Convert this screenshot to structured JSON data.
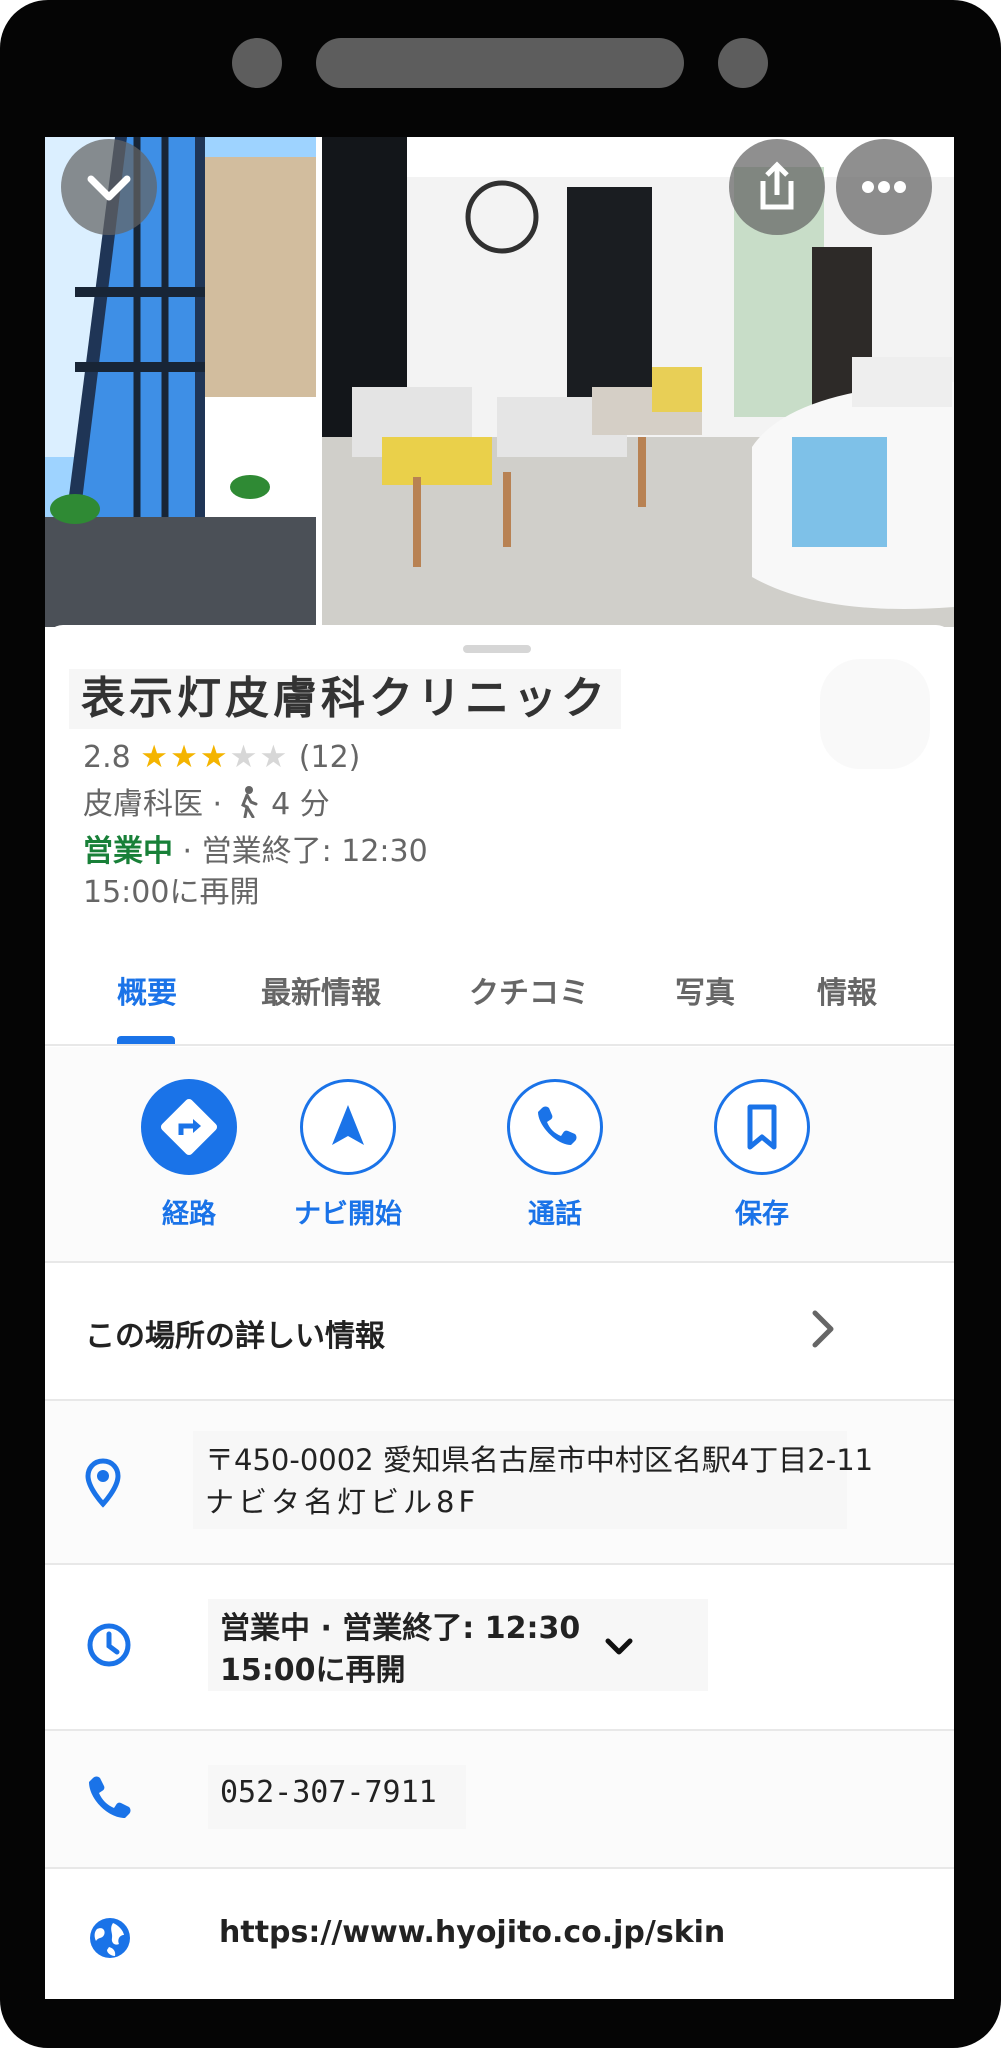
{
  "place": {
    "name": "表示灯皮膚科クリニック",
    "rating": "2.8",
    "stars_filled": 3,
    "stars_total": 5,
    "review_count": "(12)",
    "category": "皮膚科医",
    "separator": " · ",
    "walk_time": "4 分",
    "status_open": "営業中",
    "status_close": " · 営業終了: 12:30",
    "reopen": "15:00に再開"
  },
  "tabs": [
    "概要",
    "最新情報",
    "クチコミ",
    "写真",
    "情報"
  ],
  "actions": [
    {
      "label": "経路",
      "icon": "directions-icon"
    },
    {
      "label": "ナビ開始",
      "icon": "navigation-icon"
    },
    {
      "label": "通話",
      "icon": "phone-icon"
    },
    {
      "label": "保存",
      "icon": "bookmark-icon"
    }
  ],
  "details": {
    "more_info_label": "この場所の詳しい情報",
    "address_line1": "〒450-0002 愛知県名古屋市中村区名駅4丁目2-11",
    "address_line2": "ナビタ名灯ビル8F",
    "hours_line1": "営業中 · 営業終了: 12:30",
    "hours_line2": "15:00に再開",
    "phone": "052-307-7911",
    "website": "https://www.hyojito.co.jp/skin"
  },
  "colors": {
    "accent": "#1a73e8",
    "open_green": "#188038",
    "star_yellow": "#f4b400"
  }
}
